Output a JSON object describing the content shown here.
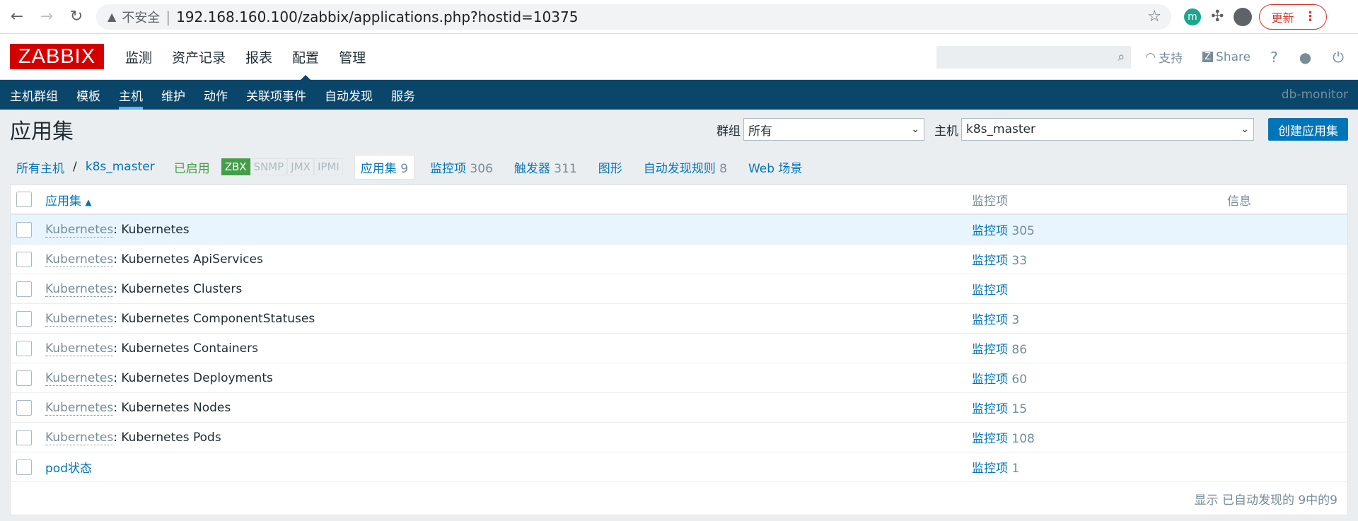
{
  "browser": {
    "insecure_label": "不安全",
    "url": "192.168.160.100/zabbix/applications.php?hostid=10375",
    "profile_initial": "m",
    "update_label": "更新"
  },
  "header": {
    "logo": "ZABBIX",
    "menu": [
      "监测",
      "资产记录",
      "报表",
      "配置",
      "管理"
    ],
    "support": "支持",
    "share": "Share",
    "help": "?"
  },
  "submenu": {
    "items": [
      "主机群组",
      "模板",
      "主机",
      "维护",
      "动作",
      "关联项事件",
      "自动发现",
      "服务"
    ],
    "server_name": "db-monitor"
  },
  "page": {
    "title": "应用集",
    "group_label": "群组",
    "group_value": "所有",
    "host_label": "主机",
    "host_value": "k8s_master",
    "create_button": "创建应用集"
  },
  "nav": {
    "all_hosts": "所有主机",
    "host": "k8s_master",
    "status": "已启用",
    "protocols": [
      "ZBX",
      "SNMP",
      "JMX",
      "IPMI"
    ],
    "tabs": [
      {
        "label": "应用集",
        "count": "9"
      },
      {
        "label": "监控项",
        "count": "306"
      },
      {
        "label": "触发器",
        "count": "311"
      },
      {
        "label": "图形",
        "count": ""
      },
      {
        "label": "自动发现规则",
        "count": "8"
      },
      {
        "label": "Web 场景",
        "count": ""
      }
    ]
  },
  "table": {
    "headers": {
      "name": "应用集",
      "items": "监控项",
      "info": "信息"
    },
    "rows": [
      {
        "template": "Kubernetes",
        "name": "Kubernetes",
        "items_label": "监控项",
        "items_count": "305"
      },
      {
        "template": "Kubernetes",
        "name": "Kubernetes ApiServices",
        "items_label": "监控项",
        "items_count": "33"
      },
      {
        "template": "Kubernetes",
        "name": "Kubernetes Clusters",
        "items_label": "监控项",
        "items_count": ""
      },
      {
        "template": "Kubernetes",
        "name": "Kubernetes ComponentStatuses",
        "items_label": "监控项",
        "items_count": "3"
      },
      {
        "template": "Kubernetes",
        "name": "Kubernetes Containers",
        "items_label": "监控项",
        "items_count": "86"
      },
      {
        "template": "Kubernetes",
        "name": "Kubernetes Deployments",
        "items_label": "监控项",
        "items_count": "60"
      },
      {
        "template": "Kubernetes",
        "name": "Kubernetes Nodes",
        "items_label": "监控项",
        "items_count": "15"
      },
      {
        "template": "Kubernetes",
        "name": "Kubernetes Pods",
        "items_label": "监控项",
        "items_count": "108"
      },
      {
        "template": "",
        "name": "pod状态",
        "items_label": "监控项",
        "items_count": "1"
      }
    ],
    "footer": "显示 已自动发现的 9中的9"
  }
}
